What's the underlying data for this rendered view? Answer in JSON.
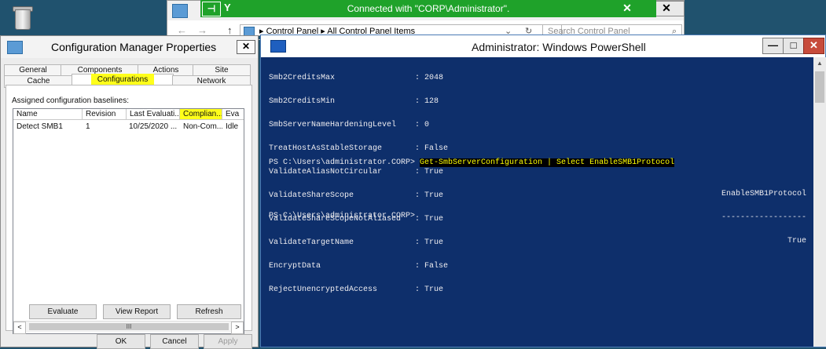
{
  "desktop": {
    "recycle_bin_icon": "recycle-bin-icon"
  },
  "control_panel": {
    "breadcrumb": "▸ Control Panel  ▸ All Control Panel Items",
    "search_placeholder": "Search Control Panel",
    "nav_back": "←",
    "nav_forward": "→",
    "nav_up": "↑",
    "refresh": "↻",
    "dropdown": "⌄",
    "search_icon": "⌕",
    "close": "✕"
  },
  "rdp_bar": {
    "pin": "⊣",
    "signal": "Y",
    "text": "Connected with \"CORP\\Administrator\".",
    "close": "✕",
    "close_outer": "✕"
  },
  "config_manager": {
    "title": "Configuration Manager Properties",
    "close": "✕",
    "tabs_row1": [
      "General",
      "Components",
      "Actions",
      "Site"
    ],
    "tabs_row2": [
      "Cache",
      "Configurations",
      "Network"
    ],
    "active_tab": "Configurations",
    "baselines_label": "Assigned configuration baselines:",
    "columns": [
      "Name",
      "Revision",
      "Last Evaluati...",
      "Complian...",
      "Eva"
    ],
    "rows": [
      [
        "Detect SMB1",
        "1",
        "10/25/2020 ...",
        "Non-Com...",
        "Idle"
      ]
    ],
    "scroll_left": "<",
    "scroll_right": ">",
    "scroll_thumb": "III",
    "buttons": {
      "evaluate": "Evaluate",
      "view_report": "View Report",
      "refresh": "Refresh"
    },
    "footer": {
      "ok": "OK",
      "cancel": "Cancel",
      "apply": "Apply"
    },
    "highlight_color": "#ffff1a"
  },
  "powershell": {
    "title": "Administrator: Windows PowerShell",
    "minimize": "—",
    "maximize": "□",
    "close": "✕",
    "properties": [
      [
        "Smb2CreditsMax",
        "2048"
      ],
      [
        "Smb2CreditsMin",
        "128"
      ],
      [
        "SmbServerNameHardeningLevel",
        "0"
      ],
      [
        "TreatHostAsStableStorage",
        "False"
      ],
      [
        "ValidateAliasNotCircular",
        "True"
      ],
      [
        "ValidateShareScope",
        "True"
      ],
      [
        "ValidateShareScopeNotAliased",
        "True"
      ],
      [
        "ValidateTargetName",
        "True"
      ],
      [
        "EncryptData",
        "False"
      ],
      [
        "RejectUnencryptedAccess",
        "True"
      ]
    ],
    "prompt1": "PS C:\\Users\\administrator.CORP> ",
    "command": "Get-SmbServerConfiguration | Select EnableSMB1Protocol",
    "output_header": "EnableSMB1Protocol",
    "output_rule": "------------------",
    "output_value": "True",
    "prompt2": "PS C:\\Users\\administrator.CORP>",
    "background": "#0e2f6b",
    "command_color": "#ffff00"
  }
}
